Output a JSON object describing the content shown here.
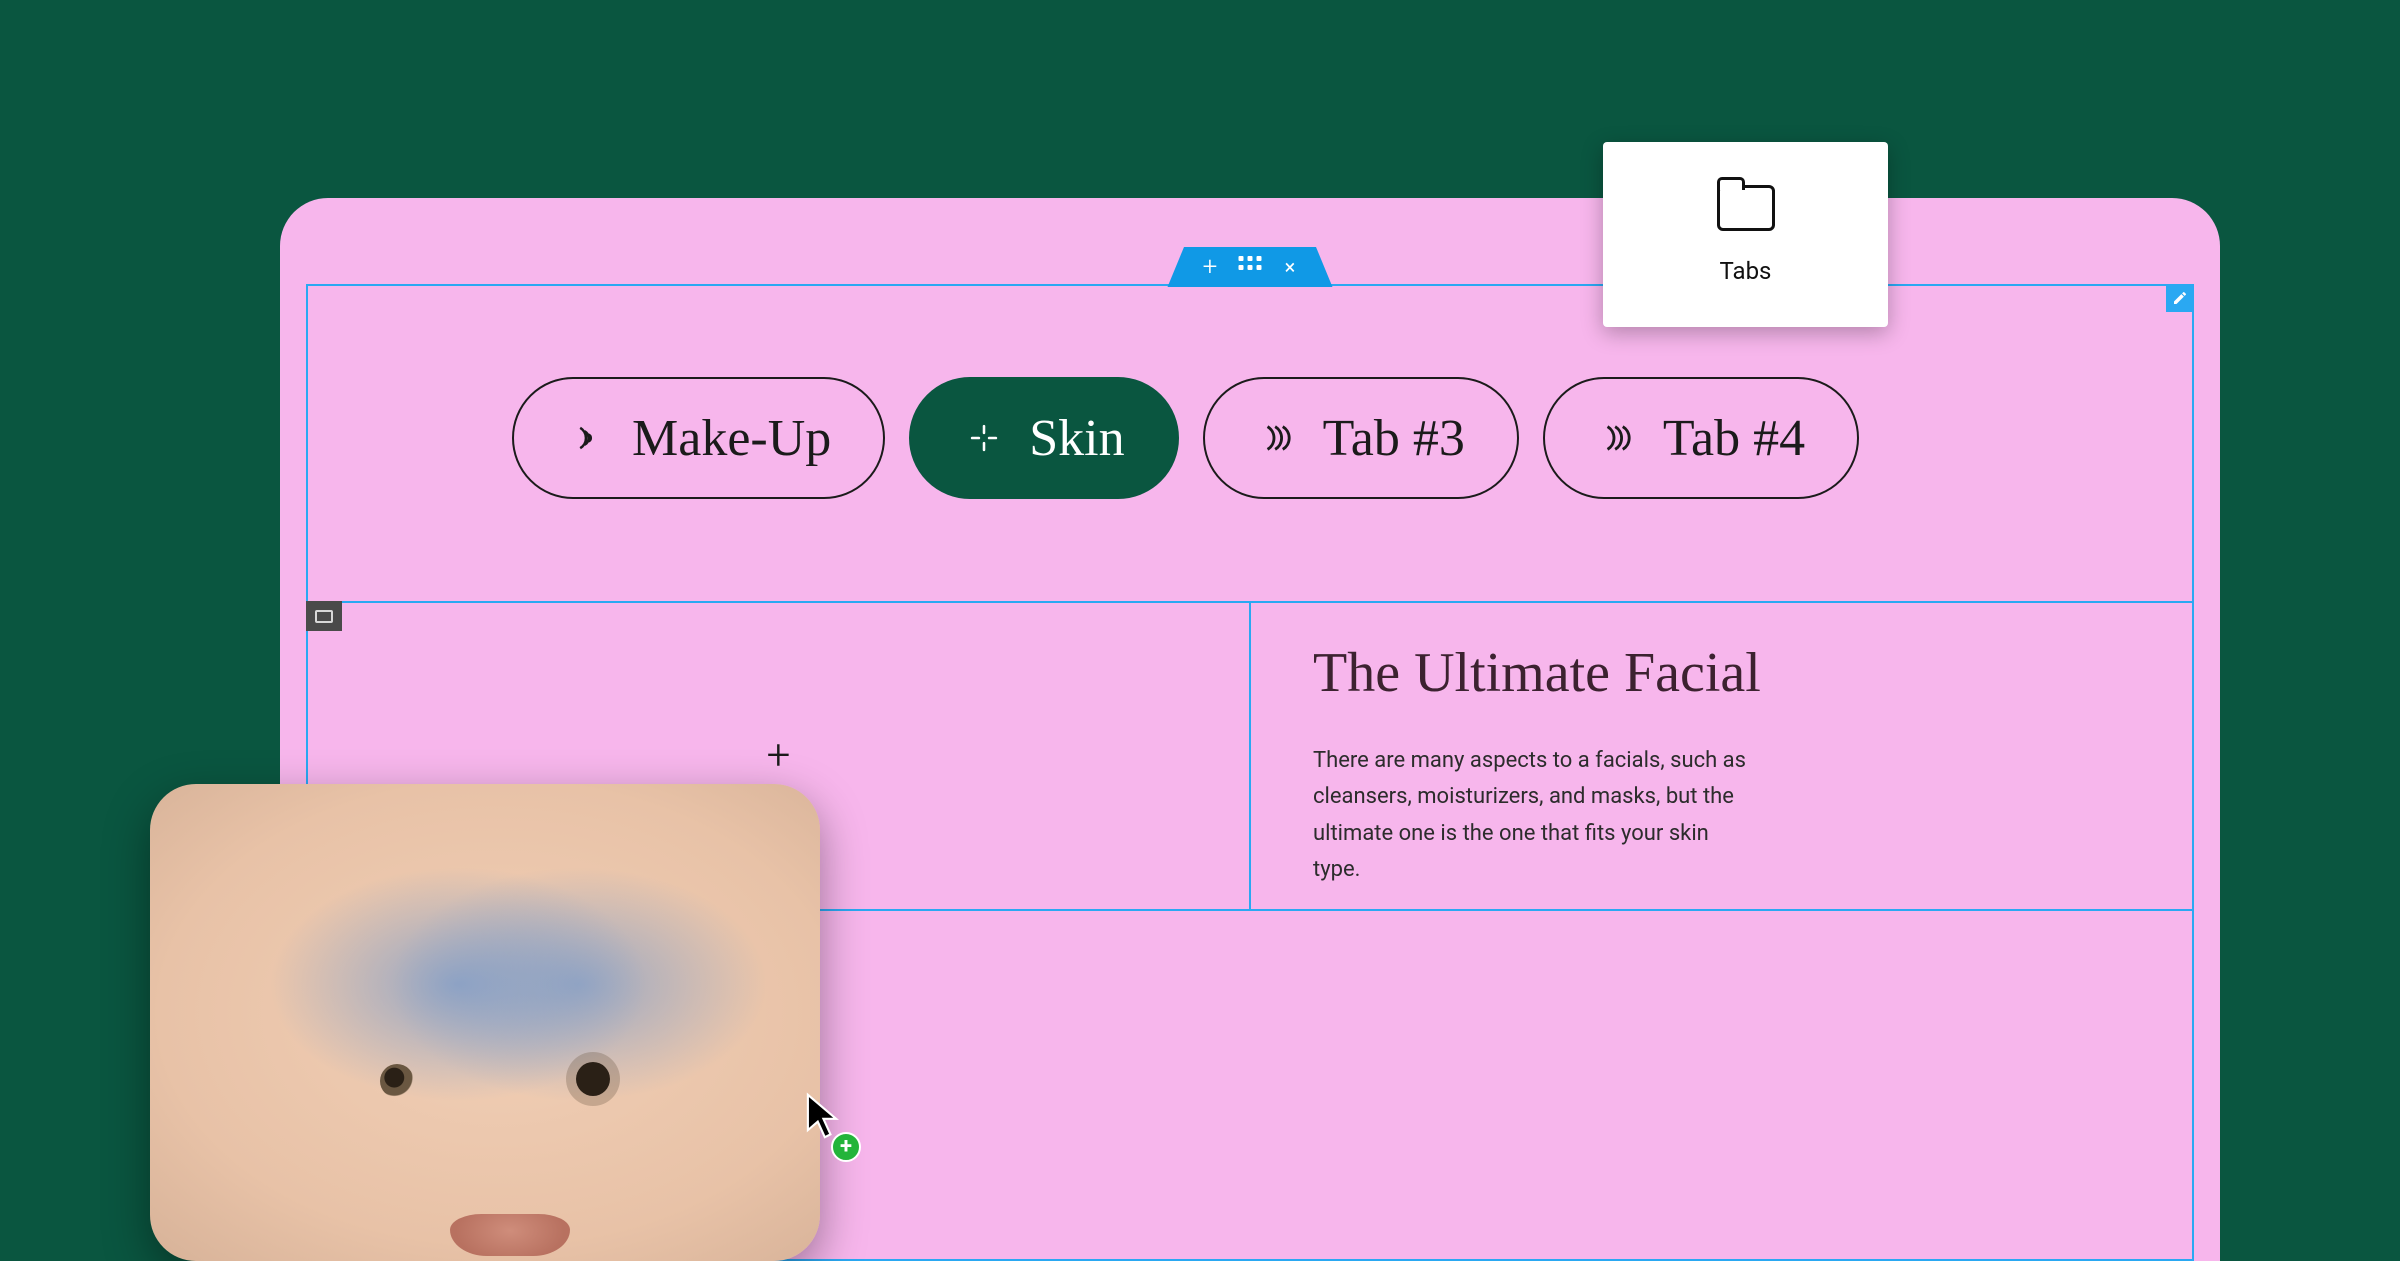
{
  "inserter": {
    "label": "Tabs",
    "icon": "tabs-icon"
  },
  "editor_tab": {
    "add": "+",
    "close": "×"
  },
  "tabs": [
    {
      "label": "Make-Up",
      "icon": "ripple",
      "active": false
    },
    {
      "label": "Skin",
      "icon": "sparkle",
      "active": true
    },
    {
      "label": "Tab #3",
      "icon": "waves",
      "active": false
    },
    {
      "label": "Tab #4",
      "icon": "waves",
      "active": false
    }
  ],
  "content": {
    "add_symbol": "+",
    "heading": "The Ultimate Facial",
    "body": "There are many aspects to a facials, such as cleansers, moisturizers, and masks, but the ultimate one is the one that fits your skin type."
  },
  "colors": {
    "background": "#0a5640",
    "canvas": "#f7b6ec",
    "editor_blue": "#1099e6",
    "frame_blue": "#2aa8f2",
    "drag_plus": "#23b43a"
  }
}
